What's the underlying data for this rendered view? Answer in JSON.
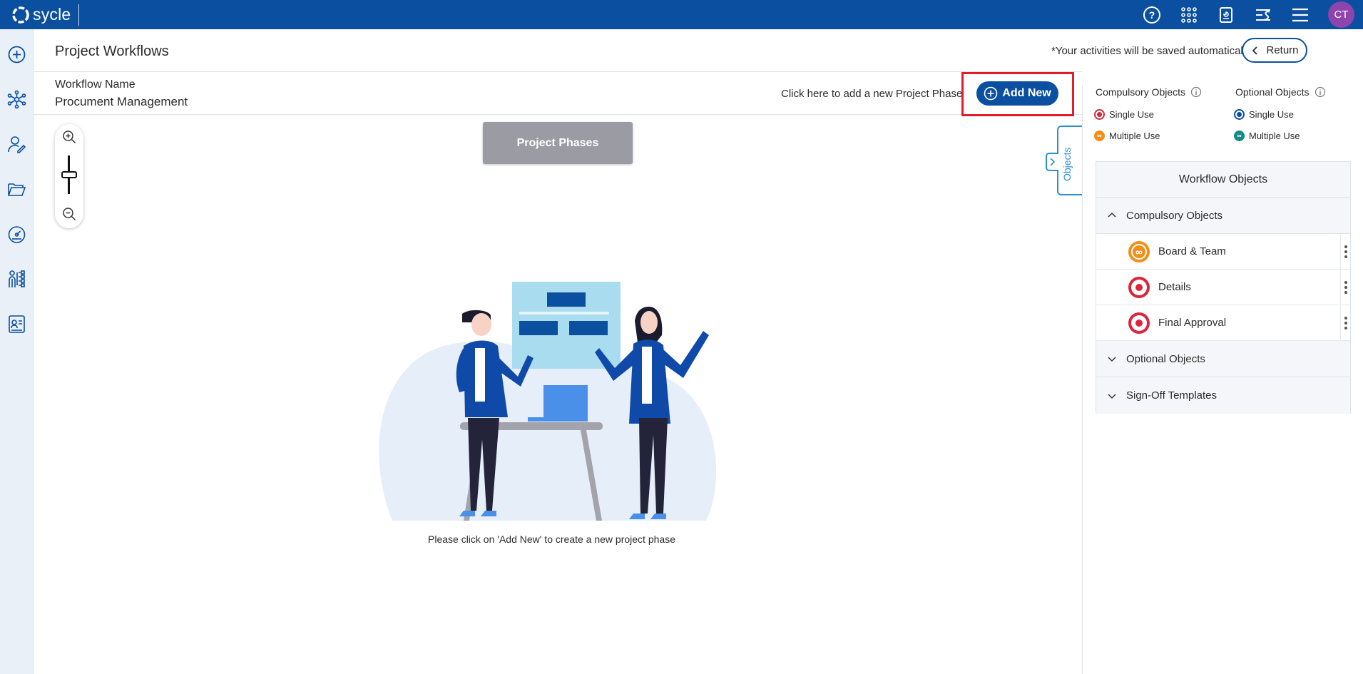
{
  "app": {
    "brand": "sycle",
    "avatar_initials": "CT"
  },
  "topbar": {
    "icons": [
      "help-icon",
      "apps-grid-icon",
      "report-icon",
      "filter-list-icon",
      "menu-icon"
    ]
  },
  "leftnav": {
    "icons": [
      "add-circle-icon",
      "network-icon",
      "user-edit-icon",
      "folders-icon",
      "dashboard-icon",
      "org-chart-icon",
      "id-card-icon"
    ]
  },
  "header": {
    "title": "Project Workflows",
    "autosave_note": "*Your activities will be saved automatically!",
    "return_label": "Return"
  },
  "workflow": {
    "name_label": "Workflow Name",
    "name_value": "Procument Management",
    "add_hint": "Click here to add a new Project Phase",
    "add_new_label": "Add New"
  },
  "canvas": {
    "phases_label": "Project Phases",
    "empty_message": "Please click on 'Add New' to create a new project phase",
    "objects_tab_label": "Objects"
  },
  "legend": {
    "compulsory_title": "Compulsory Objects",
    "optional_title": "Optional Objects",
    "single_use": "Single Use",
    "multiple_use": "Multiple Use"
  },
  "workflow_objects": {
    "title": "Workflow Objects",
    "compulsory_section": "Compulsory Objects",
    "items": [
      {
        "label": "Board & Team",
        "type": "multiple"
      },
      {
        "label": "Details",
        "type": "single"
      },
      {
        "label": "Final Approval",
        "type": "single"
      }
    ],
    "optional_section": "Optional Objects",
    "signoff_section": "Sign-Off Templates"
  },
  "colors": {
    "primary": "#0a4fa0",
    "highlight": "#e01e2a",
    "single_use_red": "#d9263a",
    "multiple_use_orange": "#f0901a",
    "optional_teal": "#138a84",
    "avatar": "#8e44ad"
  }
}
